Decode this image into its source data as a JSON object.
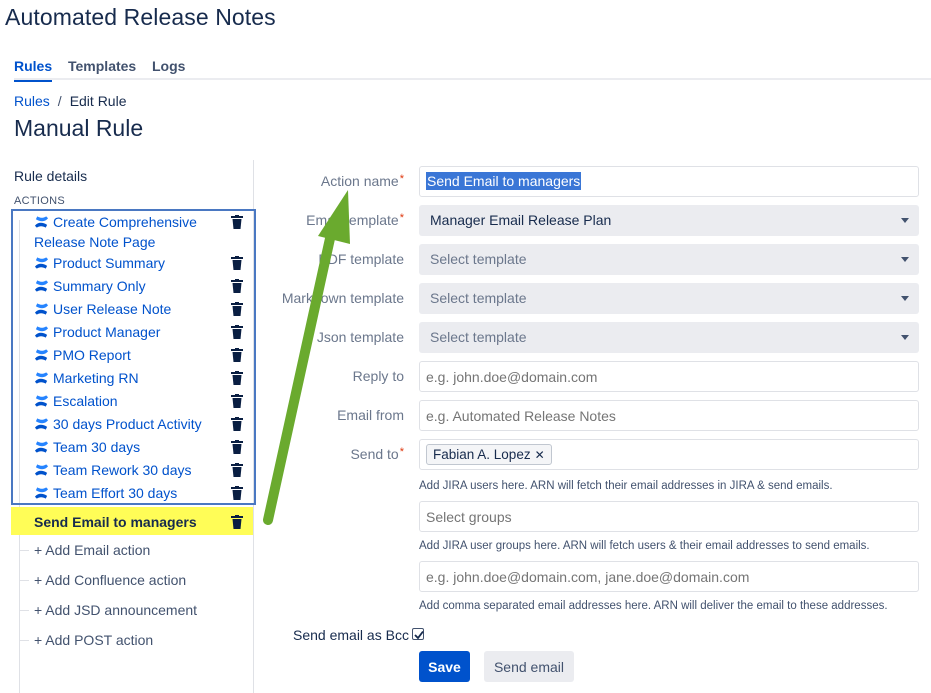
{
  "app": {
    "title": "Automated Release Notes"
  },
  "tabs": [
    {
      "label": "Rules",
      "active": true
    },
    {
      "label": "Templates",
      "active": false
    },
    {
      "label": "Logs",
      "active": false
    }
  ],
  "breadcrumb": {
    "root": "Rules",
    "separator": "/",
    "current": "Edit Rule"
  },
  "page": {
    "title": "Manual Rule"
  },
  "sidebar": {
    "rule_details": "Rule details",
    "actions_heading": "ACTIONS",
    "actions": [
      {
        "label": "Create Comprehensive Release Note Page",
        "icon": "confluence-icon"
      },
      {
        "label": "Product Summary",
        "icon": "confluence-icon"
      },
      {
        "label": "Summary Only",
        "icon": "confluence-icon"
      },
      {
        "label": "User Release Note",
        "icon": "confluence-icon"
      },
      {
        "label": "Product Manager",
        "icon": "confluence-icon"
      },
      {
        "label": "PMO Report",
        "icon": "confluence-icon"
      },
      {
        "label": "Marketing RN",
        "icon": "confluence-icon"
      },
      {
        "label": "Escalation",
        "icon": "confluence-icon"
      },
      {
        "label": "30 days Product Activity",
        "icon": "confluence-icon"
      },
      {
        "label": "Team 30 days",
        "icon": "confluence-icon"
      },
      {
        "label": "Team Rework 30 days",
        "icon": "confluence-icon"
      },
      {
        "label": "Team Effort 30 days",
        "icon": "confluence-icon"
      }
    ],
    "selected_action": "Send Email to managers",
    "add_actions": [
      "+ Add Email action",
      "+ Add Confluence action",
      "+ Add JSD announcement",
      "+ Add POST action"
    ]
  },
  "form": {
    "action_name": {
      "label": "Action name",
      "value": "Send Email to managers",
      "required": true
    },
    "email_template": {
      "label": "Email template",
      "value": "Manager Email Release Plan",
      "required": true
    },
    "pdf_template": {
      "label": "PDF template",
      "placeholder": "Select template"
    },
    "markdown_template": {
      "label": "Markdown template",
      "placeholder": "Select template"
    },
    "json_template": {
      "label": "Json template",
      "placeholder": "Select template"
    },
    "reply_to": {
      "label": "Reply to",
      "placeholder": "e.g. john.doe@domain.com"
    },
    "email_from": {
      "label": "Email from",
      "placeholder": "e.g. Automated Release Notes"
    },
    "send_to": {
      "label": "Send to",
      "required": true,
      "chips": [
        "Fabian A. Lopez"
      ],
      "help": "Add JIRA users here. ARN will fetch their email addresses in JIRA & send emails."
    },
    "groups": {
      "placeholder": "Select groups",
      "help": "Add JIRA user groups here. ARN will fetch users & their email addresses to send emails."
    },
    "emails": {
      "placeholder": "e.g. john.doe@domain.com, jane.doe@domain.com",
      "help": "Add comma separated email addresses here. ARN will deliver the email to these addresses."
    },
    "bcc": {
      "label": "Send email as Bcc",
      "checked": true
    },
    "save_label": "Save",
    "send_label": "Send email"
  },
  "colors": {
    "primary": "#0052cc",
    "annotation_box": "#4a78c2",
    "highlight": "#fffd57",
    "arrow": "#6aaa2e"
  }
}
